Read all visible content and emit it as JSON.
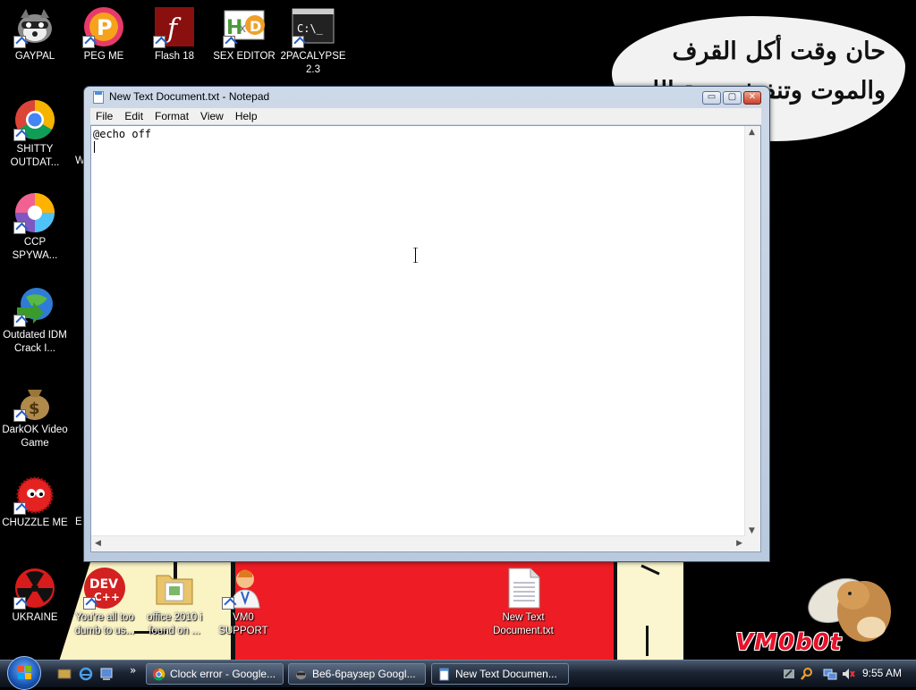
{
  "desktop": {
    "icons": [
      {
        "label": "GAYPAL"
      },
      {
        "label": "PEG ME"
      },
      {
        "label": "Flash 18"
      },
      {
        "label": "SEX EDITOR"
      },
      {
        "label": "2PACALYPSE 2.3"
      },
      {
        "label": "SHITTY OUTDAT..."
      },
      {
        "label": "CCP SPYWA..."
      },
      {
        "label": "Outdated IDM Crack I..."
      },
      {
        "label": "DarkOK Video Game"
      },
      {
        "label": "CHUZZLE ME"
      },
      {
        "label": "UKRAINE"
      },
      {
        "label": "You're all too dumb to us..."
      },
      {
        "label": "office 2010 i found on ..."
      },
      {
        "label": "VM0 SUPPORT"
      },
      {
        "label": "New Text Document.txt"
      }
    ],
    "partial_labels": {
      "w": "W",
      "e": "E"
    },
    "wallpaper": {
      "speech_line1": "حان وقت أكل القرف",
      "speech_line2": "والموت وتنفيذ ضربة الله",
      "logo_text": "VM0b0t"
    }
  },
  "notepad": {
    "title": "New Text Document.txt - Notepad",
    "menu": [
      "File",
      "Edit",
      "Format",
      "View",
      "Help"
    ],
    "content": "@echo off",
    "buttons": {
      "minimize": "▭",
      "maximize": "▢",
      "close": "✕"
    }
  },
  "taskbar": {
    "tasks": [
      {
        "label": "Clock error - Google..."
      },
      {
        "label": "Be6-6payзep Googl..."
      },
      {
        "label": "New Text Documen..."
      }
    ],
    "quicklaunch_more": "»",
    "clock": "9:55 AM"
  },
  "colors": {
    "wallpaper_red": "#ee1c24",
    "wallpaper_cream": "#faf3c4",
    "taskbar": "#1b2433",
    "logo_red": "#e8122a"
  }
}
